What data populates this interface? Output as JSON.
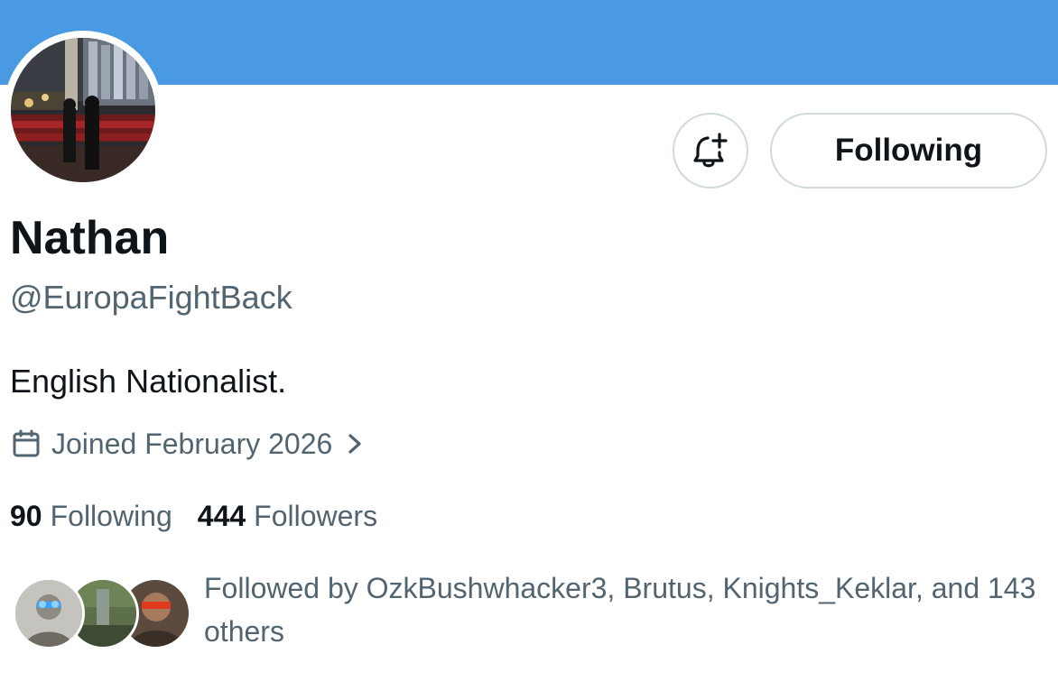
{
  "profile": {
    "display_name": "Nathan",
    "handle": "@EuropaFightBack",
    "bio": "English Nationalist.",
    "joined": "Joined February 2026",
    "following_count": "90",
    "following_label": "Following",
    "followers_count": "444",
    "followers_label": "Followers"
  },
  "actions": {
    "following_button_label": "Following"
  },
  "followed_by": {
    "text": "Followed by OzkBushwhacker3, Brutus, Knights_Keklar, and 143 others"
  },
  "icons": {
    "notify": "bell-plus-icon",
    "joined": "calendar-icon",
    "joined_more": "chevron-right-icon"
  },
  "colors": {
    "banner": "#4a99e3",
    "secondary_text": "#536471",
    "primary_text": "#0f1419",
    "border": "#cfd9de"
  }
}
